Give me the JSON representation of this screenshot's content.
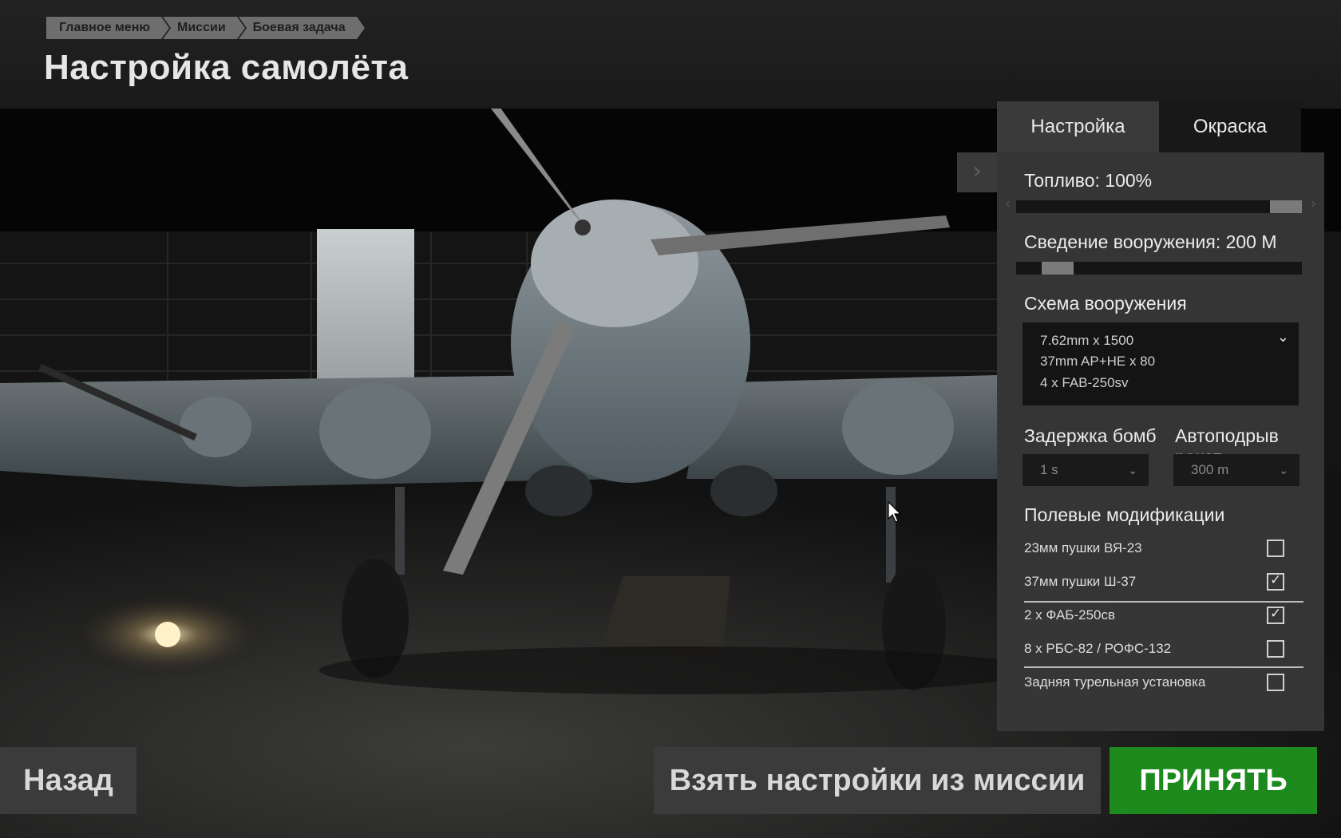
{
  "breadcrumb": [
    "Главное меню",
    "Миссии",
    "Боевая задача"
  ],
  "page_title": "Настройка самолёта",
  "tabs": [
    {
      "label": "Настройка",
      "active": true
    },
    {
      "label": "Окраска",
      "active": false
    }
  ],
  "panel": {
    "fuel_label": "Топливо: 100%",
    "fuel_value_percent": 100,
    "convergence_label": "Сведение вооружения: 200 М",
    "weapon_scheme_label": "Схема вооружения",
    "weapon_scheme_lines": [
      "7.62mm x 1500",
      "37mm AP+HE x 80",
      "4 x FAB-250sv"
    ],
    "bomb_delay_label": "Задержка бомб",
    "bomb_delay_value": "1 s",
    "rocket_autodet_label": "Автоподрыв ракет",
    "rocket_autodet_value": "300 m",
    "field_mods_label": "Полевые модификации",
    "mods": [
      {
        "label": "23мм пушки ВЯ-23",
        "checked": false
      },
      {
        "label": "37мм пушки Ш-37",
        "checked": true
      },
      {
        "label": "2 x ФАБ-250св",
        "checked": true
      },
      {
        "label": "8 x РБС-82 / РОФС-132",
        "checked": false
      },
      {
        "label": "Задняя турельная установка",
        "checked": false
      }
    ]
  },
  "buttons": {
    "back": "Назад",
    "take_from_mission": "Взять настройки из миссии",
    "accept": "ПРИНЯТЬ"
  },
  "colors": {
    "accept": "#1c8a1c",
    "panel": "#373737",
    "breadcrumb": "#6e6e6e"
  },
  "icons": {
    "collapse": "chevron-right-icon",
    "dropdown": "chevron-down-icon",
    "checkmark": "check-icon",
    "cursor": "mouse-pointer-icon"
  }
}
